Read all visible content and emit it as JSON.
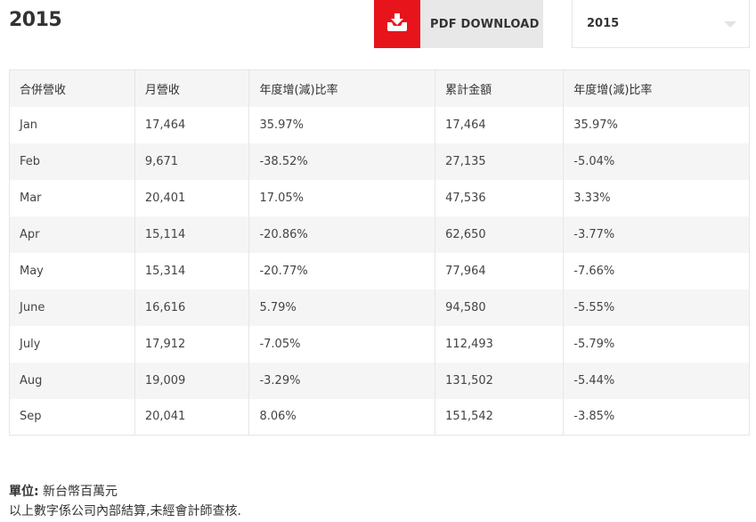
{
  "header": {
    "title": "2015",
    "pdf_button_label": "PDF DOWNLOAD",
    "pdf_icon": "download-tray-icon",
    "accent_color": "#e8141b"
  },
  "year_select": {
    "value": "2015"
  },
  "table": {
    "columns": [
      "合併營收",
      "月營收",
      "年度增(減)比率",
      "累計金額",
      "年度增(減)比率"
    ],
    "rows": [
      [
        "Jan",
        "17,464",
        "35.97%",
        "17,464",
        "35.97%"
      ],
      [
        "Feb",
        "9,671",
        "-38.52%",
        "27,135",
        "-5.04%"
      ],
      [
        "Mar",
        "20,401",
        "17.05%",
        "47,536",
        "3.33%"
      ],
      [
        "Apr",
        "15,114",
        "-20.86%",
        "62,650",
        "-3.77%"
      ],
      [
        "May",
        "15,314",
        "-20.77%",
        "77,964",
        "-7.66%"
      ],
      [
        "June",
        "16,616",
        "5.79%",
        "94,580",
        "-5.55%"
      ],
      [
        "July",
        "17,912",
        "-7.05%",
        "112,493",
        "-5.79%"
      ],
      [
        "Aug",
        "19,009",
        "-3.29%",
        "131,502",
        "-5.44%"
      ],
      [
        "Sep",
        "20,041",
        "8.06%",
        "151,542",
        "-3.85%"
      ]
    ]
  },
  "footnote": {
    "unit_label": "單位:",
    "unit_value": " 新台幣百萬元",
    "note": "以上數字係公司內部結算,未經會計師查核."
  }
}
